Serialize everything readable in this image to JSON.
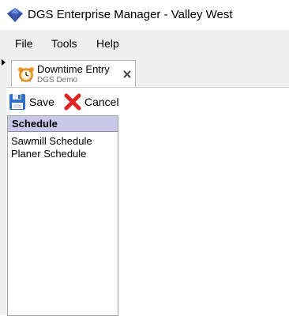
{
  "window": {
    "title": "DGS Enterprise Manager - Valley West",
    "icon": "diamond-logo-icon",
    "brand_color": "#3b5bb5"
  },
  "menu": {
    "items": [
      {
        "label": "File"
      },
      {
        "label": "Tools"
      },
      {
        "label": "Help"
      }
    ]
  },
  "tab": {
    "title": "Downtime Entry",
    "subtitle": "DGS Demo",
    "icon": "alarm-clock-icon",
    "close_icon": "close-icon"
  },
  "toolbar": {
    "save_label": "Save",
    "save_icon": "floppy-disk-icon",
    "cancel_label": "Cancel",
    "cancel_icon": "red-x-icon"
  },
  "schedule_panel": {
    "header": "Schedule",
    "header_color": "#c9c7ea",
    "items": [
      {
        "label": "Sawmill Schedule"
      },
      {
        "label": "Planer Schedule"
      }
    ]
  }
}
